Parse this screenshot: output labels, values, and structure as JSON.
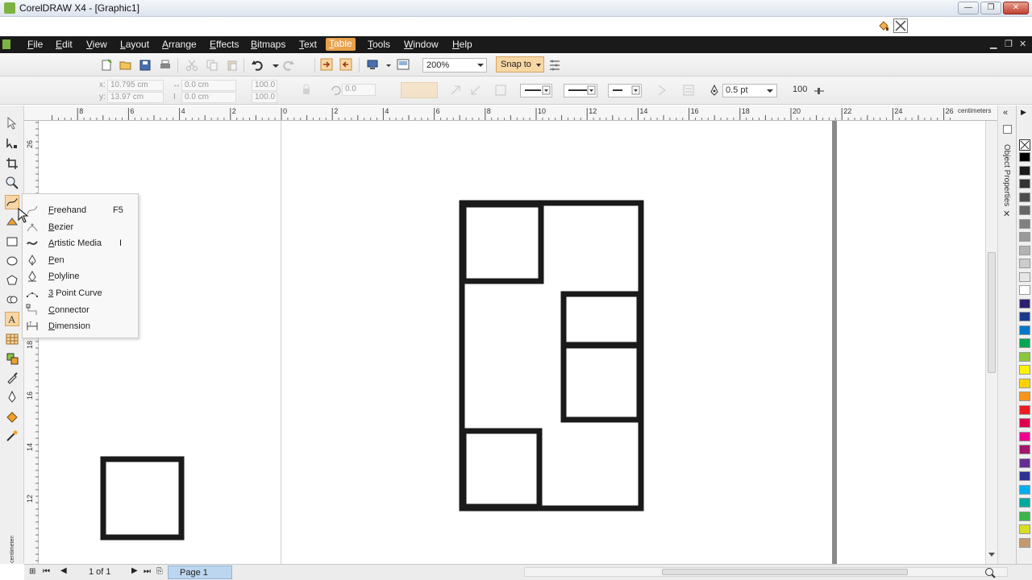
{
  "window": {
    "title": "CorelDRAW X4 - [Graphic1]",
    "controls": [
      "—",
      "❐",
      "✕"
    ]
  },
  "menu": {
    "items": [
      {
        "first": "F",
        "rest": "ile"
      },
      {
        "first": "E",
        "rest": "dit"
      },
      {
        "first": "V",
        "rest": "iew"
      },
      {
        "first": "L",
        "rest": "ayout"
      },
      {
        "first": "A",
        "rest": "rrange"
      },
      {
        "first": "E",
        "rest": "ffects"
      },
      {
        "first": "B",
        "rest": "itmaps"
      },
      {
        "first": "T",
        "rest": "ext"
      },
      {
        "first": "T",
        "rest": "able"
      },
      {
        "first": "T",
        "rest": "ools"
      },
      {
        "first": "W",
        "rest": "indow"
      },
      {
        "first": "H",
        "rest": "elp"
      }
    ],
    "active_index": 8
  },
  "standard_toolbar": {
    "zoom_value": "200%",
    "snap_label": "Snap to"
  },
  "property_bar": {
    "x_label": "x:",
    "x_value": "10.795 cm",
    "y_label": "y:",
    "y_value": "13.97 cm",
    "w_value": "0.0 cm",
    "h_value": "0.0 cm",
    "scale_w": "100.0",
    "scale_h": "100.0",
    "angle": "0.0",
    "outline_width": "0.5 pt",
    "smoothing": "100"
  },
  "ruler": {
    "h_labels": [
      "8",
      "6",
      "4",
      "2",
      "0",
      "2",
      "4",
      "6",
      "8",
      "10",
      "12",
      "14",
      "16",
      "18",
      "20",
      "22",
      "24",
      "26"
    ],
    "h_unit": "centimeters",
    "v_labels": [
      "26",
      "18",
      "16",
      "14",
      "12"
    ],
    "v_unit": "centimeters"
  },
  "flyout": {
    "items": [
      {
        "ul": "F",
        "rest": "reehand",
        "shortcut": "F5",
        "icon": "freehand-icon"
      },
      {
        "ul": "B",
        "rest": "ezier",
        "shortcut": "",
        "icon": "bezier-icon"
      },
      {
        "ul": "A",
        "rest": "rtistic Media",
        "shortcut": "I",
        "icon": "artistic-media-icon"
      },
      {
        "ul": "P",
        "rest": "en",
        "shortcut": "",
        "icon": "pen-icon"
      },
      {
        "ul": "P",
        "rest": "olyline",
        "shortcut": "",
        "icon": "polyline-icon"
      },
      {
        "ul": "3",
        "rest": " Point Curve",
        "shortcut": "",
        "icon": "3-point-curve-icon"
      },
      {
        "ul": "C",
        "rest": "onnector",
        "shortcut": "",
        "icon": "connector-icon"
      },
      {
        "ul": "D",
        "rest": "imension",
        "shortcut": "",
        "icon": "dimension-icon"
      }
    ]
  },
  "docker": {
    "title": "Object Properties"
  },
  "palette": {
    "colors": [
      "#000000",
      "#1a1a1a",
      "#333333",
      "#4d4d4d",
      "#666666",
      "#808080",
      "#999999",
      "#b3b3b3",
      "#cccccc",
      "#e6e6e6",
      "#ffffff",
      "#2e1f6e",
      "#1b3c8c",
      "#0077c8",
      "#00a651",
      "#8cc63f",
      "#fff200",
      "#ffd200",
      "#f7941d",
      "#ed1c24",
      "#e0004d",
      "#ec008c",
      "#a0186b",
      "#662d91",
      "#2e3192",
      "#00aeef",
      "#00a99d",
      "#39b54a",
      "#d7df23",
      "#c49a6c"
    ]
  },
  "status": {
    "page_count": "1 of 1",
    "page_tab": "Page 1"
  }
}
